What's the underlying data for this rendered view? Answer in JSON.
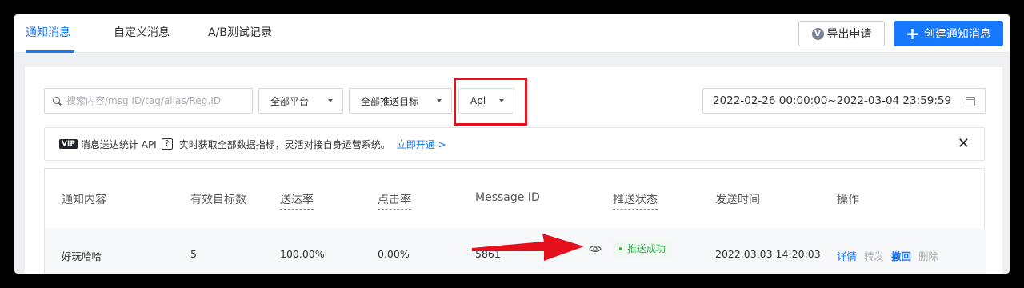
{
  "tabs": [
    {
      "label": "通知消息",
      "active": true
    },
    {
      "label": "自定义消息",
      "active": false
    },
    {
      "label": "A/B测试记录",
      "active": false
    }
  ],
  "actions": {
    "export_label": "导出申请",
    "export_badge": "V",
    "create_label": "创建通知消息",
    "create_icon": "plus-icon"
  },
  "filters": {
    "search_placeholder": "搜索内容/msg ID/tag/alias/Reg.ID",
    "platform": "全部平台",
    "target": "全部推送目标",
    "source": "Api",
    "date_range": "2022-02-26 00:00:00~2022-03-04 23:59:59"
  },
  "banner": {
    "vip": "VIP",
    "title": "消息送达统计 API",
    "help": "?",
    "text": "实时获取全部数据指标，灵活对接自身运营系统。",
    "link": "立即开通 >",
    "close": "✕"
  },
  "table": {
    "headers": [
      "通知内容",
      "有效目标数",
      "送达率",
      "点击率",
      "Message ID",
      "推送状态",
      "发送时间",
      "操作"
    ],
    "rows": [
      {
        "content": "好玩哈哈",
        "targets": "5",
        "delivery_rate": "100.00%",
        "click_rate": "0.00%",
        "message_id": "5861",
        "status": "推送成功",
        "sent_time": "2022.03.03 14:20:03",
        "ops": [
          "详情",
          "转发",
          "撤回",
          "删除"
        ]
      }
    ]
  },
  "colors": {
    "accent": "#1677ff",
    "highlight": "#e5101c",
    "success": "#2bb24c"
  }
}
